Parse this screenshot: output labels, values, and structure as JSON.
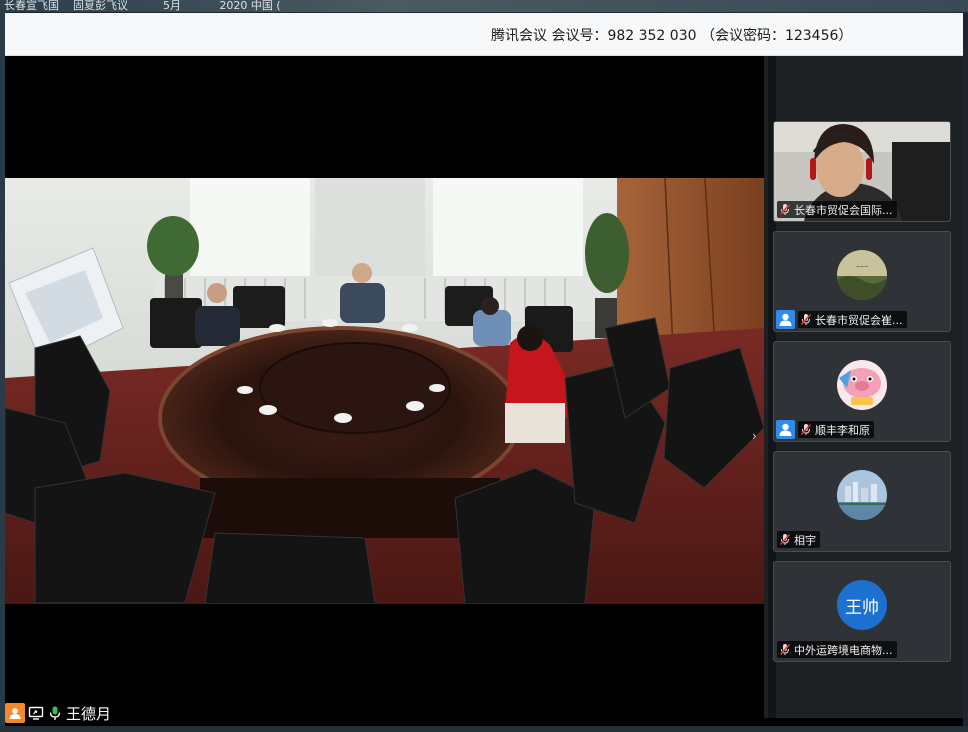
{
  "desktop": {
    "top_text": "长春宣飞国    固夏彭飞议          5月           2020 中国 ("
  },
  "window": {
    "title": "腾讯会议 会议号：982 352 030 （会议密码：123456）"
  },
  "self": {
    "name": "王德月"
  },
  "participants": [
    {
      "name": "长春市贸促会国际...",
      "type": "video",
      "mic": "muted"
    },
    {
      "name": "长春市贸促会崔...",
      "type": "image-avatar",
      "mic": "muted",
      "icon": "user-icon"
    },
    {
      "name": "顺丰李和原",
      "type": "cartoon-avatar",
      "mic": "muted",
      "icon": "user-icon"
    },
    {
      "name": "相宇",
      "type": "city-avatar",
      "mic": "muted"
    },
    {
      "name": "中外运跨境电商物...",
      "type": "text-avatar",
      "avatar_text": "王帅",
      "mic": "muted"
    }
  ],
  "colors": {
    "text_avatar_bg": "#1d6fd0",
    "user_badge": "#2f8ceb",
    "self_badge": "#f08a2c",
    "mute_red": "#e0302c"
  }
}
